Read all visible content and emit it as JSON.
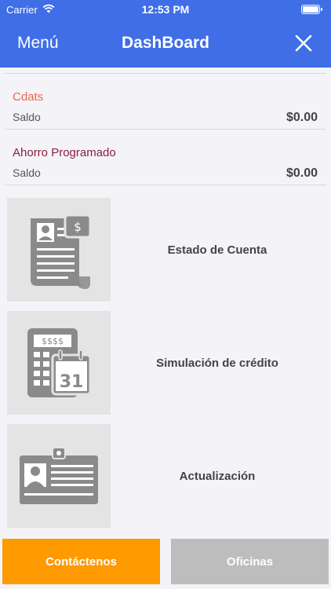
{
  "status": {
    "carrier": "Carrier",
    "time": "12:53 PM"
  },
  "nav": {
    "menu_label": "Menú",
    "title": "DashBoard"
  },
  "accounts": [
    {
      "name": "Cdats",
      "label": "Saldo",
      "amount": "$0.00",
      "name_color": "#e8694a"
    },
    {
      "name": "Ahorro Programado",
      "label": "Saldo",
      "amount": "$0.00",
      "name_color": "#8a1f3c"
    }
  ],
  "menu": [
    {
      "label": "Estado de Cuenta",
      "icon": "account-statement-icon",
      "icon_text": "$"
    },
    {
      "label": "Simulación de crédito",
      "icon": "calculator-calendar-icon",
      "icon_text": "$$$$",
      "icon_day": "31"
    },
    {
      "label": "Actualización",
      "icon": "id-card-icon"
    }
  ],
  "buttons": {
    "contact": "Contáctenos",
    "offices": "Oficinas"
  },
  "colors": {
    "primary": "#3f6ee6",
    "accent": "#ff9a00",
    "disabled": "#bdbdbd",
    "icon_gray": "#8a8a8a"
  }
}
